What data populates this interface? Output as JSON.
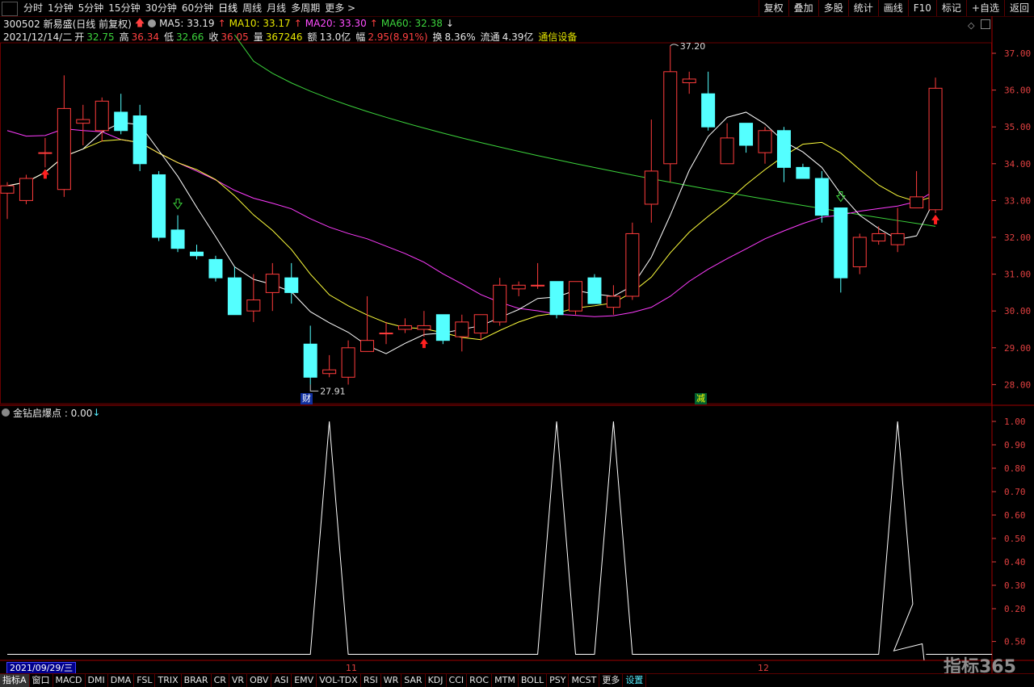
{
  "toolbar": {
    "left_items": [
      "分时",
      "1分钟",
      "5分钟",
      "15分钟",
      "30分钟",
      "60分钟",
      "日线",
      "周线",
      "月线",
      "多周期",
      "更多 >"
    ],
    "active": "日线",
    "right_items": [
      "复权",
      "叠加",
      "多股",
      "统计",
      "画线",
      "F10",
      "标记",
      "+自选",
      "返回"
    ]
  },
  "info": {
    "code_name": "300502 新易盛(日线 前复权)",
    "ma5": "MA5: 33.19",
    "ma10": "MA10: 33.17",
    "ma20": "MA20: 33.30",
    "ma60": "MA60: 32.38",
    "date": "2021/12/14/二",
    "open_label": "开",
    "open": "32.75",
    "high_label": "高",
    "high": "36.34",
    "low_label": "低",
    "low": "32.66",
    "close_label": "收",
    "close": "36.05",
    "vol_label": "量",
    "vol": "367246",
    "amt_label": "额",
    "amt": "13.0亿",
    "chg_label": "幅",
    "chg": "2.95(8.91%)",
    "turn_label": "换",
    "turn": "8.36%",
    "float_label": "流通",
    "float": "4.39亿",
    "industry": "通信设备"
  },
  "indicator": {
    "title": "金钻启爆点 : 0.00"
  },
  "annotations": {
    "high_label": "37.20",
    "low_label": "27.91",
    "cai": "财",
    "jian": "减"
  },
  "price_axis": [
    "37.00",
    "36.00",
    "35.00",
    "34.00",
    "33.00",
    "32.00",
    "31.00",
    "30.00",
    "29.00",
    "28.00"
  ],
  "ind_axis": [
    "1.00",
    "0.90",
    "0.80",
    "0.70",
    "0.60",
    "0.50",
    "0.40",
    "0.30",
    "0.20",
    "0.50"
  ],
  "x_axis": {
    "start": "2021/09/29/三",
    "m11": "11",
    "m12": "12"
  },
  "bottom_tabs": [
    "指标A",
    "窗口",
    "MACD",
    "DMI",
    "DMA",
    "FSL",
    "TRIX",
    "BRAR",
    "CR",
    "VR",
    "OBV",
    "ASI",
    "EMV",
    "VOL-TDX",
    "RSI",
    "WR",
    "SAR",
    "KDJ",
    "CCI",
    "ROC",
    "MTM",
    "BOLL",
    "PSY",
    "MCST",
    "更多",
    "设置"
  ],
  "logo": "指标365",
  "colors": {
    "up": "#ff3c3c",
    "down": "#54ffff",
    "ma5": "#ffffff",
    "ma10": "#ffff3c",
    "ma20": "#ff3cff",
    "ma60": "#3cd43c",
    "ind": "#ffffff",
    "grid": "#6a0000"
  },
  "chart_data": {
    "type": "candlestick",
    "candles": [
      [
        33.2,
        33.5,
        32.5,
        33.4
      ],
      [
        33.0,
        33.7,
        32.9,
        33.6
      ],
      [
        34.3,
        34.7,
        33.9,
        34.3
      ],
      [
        33.3,
        36.4,
        33.1,
        35.5
      ],
      [
        35.1,
        35.6,
        34.5,
        35.2
      ],
      [
        34.9,
        35.8,
        34.6,
        35.7
      ],
      [
        35.4,
        35.9,
        34.8,
        34.9
      ],
      [
        35.3,
        35.6,
        33.8,
        34.0
      ],
      [
        33.7,
        33.8,
        31.9,
        32.0
      ],
      [
        32.2,
        32.6,
        31.6,
        31.7
      ],
      [
        31.6,
        31.8,
        31.4,
        31.5
      ],
      [
        31.4,
        31.5,
        30.8,
        30.9
      ],
      [
        30.9,
        31.2,
        29.9,
        29.9
      ],
      [
        30.0,
        31.0,
        29.7,
        30.3
      ],
      [
        30.5,
        31.3,
        30.0,
        31.0
      ],
      [
        30.9,
        31.3,
        30.2,
        30.5
      ],
      [
        29.1,
        29.6,
        28.0,
        28.2
      ],
      [
        28.3,
        28.8,
        28.2,
        28.4
      ],
      [
        28.2,
        29.2,
        28.0,
        29.0
      ],
      [
        28.9,
        30.4,
        28.9,
        29.2
      ],
      [
        29.4,
        29.7,
        29.1,
        29.4
      ],
      [
        29.5,
        29.8,
        29.4,
        29.6
      ],
      [
        29.5,
        30.0,
        29.3,
        29.6
      ],
      [
        29.9,
        29.9,
        29.1,
        29.2
      ],
      [
        29.3,
        29.9,
        28.9,
        29.7
      ],
      [
        29.4,
        29.9,
        29.2,
        29.9
      ],
      [
        29.7,
        30.9,
        29.6,
        30.7
      ],
      [
        30.6,
        30.8,
        30.4,
        30.7
      ],
      [
        30.7,
        31.3,
        30.6,
        30.7
      ],
      [
        30.8,
        30.8,
        29.8,
        29.9
      ],
      [
        30.0,
        30.8,
        29.9,
        30.8
      ],
      [
        30.9,
        31.0,
        30.2,
        30.2
      ],
      [
        30.1,
        30.7,
        29.9,
        30.4
      ],
      [
        30.4,
        32.4,
        30.3,
        32.1
      ],
      [
        32.9,
        35.2,
        32.4,
        33.8
      ],
      [
        34.0,
        37.2,
        33.5,
        36.5
      ],
      [
        36.2,
        36.5,
        35.9,
        36.3
      ],
      [
        35.9,
        36.5,
        34.9,
        35.0
      ],
      [
        34.0,
        35.1,
        34.0,
        34.7
      ],
      [
        35.1,
        35.1,
        34.3,
        34.5
      ],
      [
        34.3,
        35.0,
        34.0,
        34.9
      ],
      [
        34.9,
        35.0,
        33.5,
        33.9
      ],
      [
        33.9,
        34.0,
        33.7,
        33.6
      ],
      [
        33.6,
        33.8,
        32.4,
        32.6
      ],
      [
        32.8,
        32.8,
        30.5,
        30.9
      ],
      [
        31.2,
        32.1,
        31.0,
        32.0
      ],
      [
        31.9,
        32.3,
        31.8,
        32.1
      ],
      [
        31.8,
        32.8,
        31.6,
        32.1
      ],
      [
        32.8,
        33.8,
        32.8,
        33.1
      ],
      [
        32.75,
        36.34,
        32.66,
        36.05
      ]
    ],
    "ma60_range": [
      35.5,
      32.38
    ],
    "indicator_peaks_days": [
      17,
      29,
      32,
      47
    ]
  }
}
